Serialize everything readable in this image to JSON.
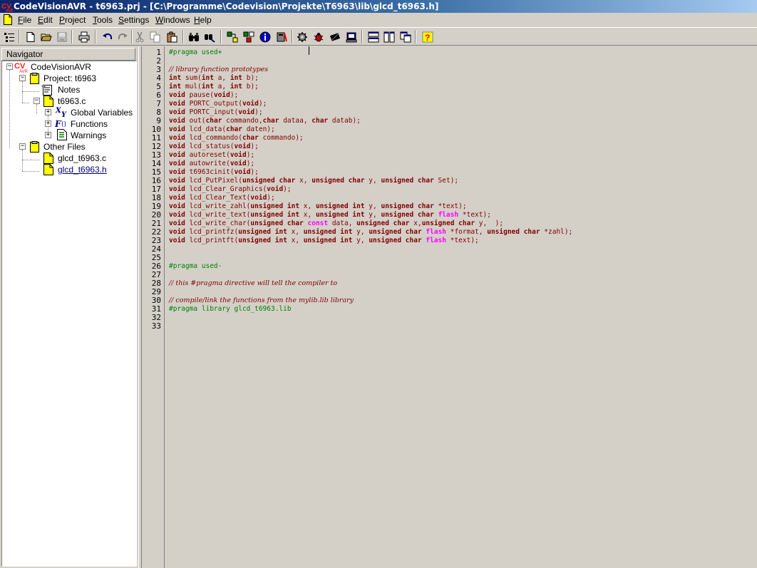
{
  "window": {
    "title": "CodeVisionAVR - t6963.prj - [C:\\Programme\\Codevision\\Projekte\\T6963\\lib\\glcd_t6963.h]"
  },
  "menu": {
    "items": [
      "File",
      "Edit",
      "Project",
      "Tools",
      "Settings",
      "Windows",
      "Help"
    ],
    "accelerators": [
      "F",
      "E",
      "P",
      "T",
      "S",
      "W",
      "H"
    ]
  },
  "toolbar": {
    "buttons": [
      "navigator-icon",
      "new-file-icon",
      "open-file-icon",
      "save-icon",
      "print-icon",
      "undo-icon",
      "redo-icon",
      "cut-icon",
      "copy-icon",
      "paste-icon",
      "find-icon",
      "replace-icon",
      "check-syntax-icon",
      "compile-icon",
      "info-icon",
      "make-icon",
      "settings-gear-icon",
      "debugger-bug-icon",
      "chip-programmer-icon",
      "terminal-icon",
      "tile-horizontal-icon",
      "tile-vertical-icon",
      "cascade-icon",
      "help-icon"
    ]
  },
  "navigator": {
    "header": "Navigator",
    "tree": {
      "root": "CodeVisionAVR",
      "project": "Project: t6963",
      "notes": "Notes",
      "source": "t6963.c",
      "global_vars": "Global Variables",
      "functions": "Functions",
      "warnings": "Warnings",
      "other_files": "Other Files",
      "file1": "glcd_t6963.c",
      "file2": "glcd_t6963.h"
    }
  },
  "editor": {
    "line_numbers": [
      "1",
      "2",
      "3",
      "4",
      "5",
      "6",
      "7",
      "8",
      "9",
      "10",
      "11",
      "12",
      "13",
      "14",
      "15",
      "16",
      "17",
      "18",
      "19",
      "20",
      "21",
      "22",
      "23",
      "24",
      "25",
      "26",
      "27",
      "28",
      "29",
      "30",
      "31",
      "32",
      "33"
    ],
    "lines": [
      [
        [
          "pp",
          "#pragma used+"
        ]
      ],
      [],
      [
        [
          "cm",
          "// library function prototypes"
        ]
      ],
      [
        [
          "kw",
          "int"
        ],
        [
          "t",
          " sum("
        ],
        [
          "kw",
          "int"
        ],
        [
          "t",
          " a, "
        ],
        [
          "kw",
          "int"
        ],
        [
          "t",
          " b);"
        ]
      ],
      [
        [
          "kw",
          "int"
        ],
        [
          "t",
          " mul("
        ],
        [
          "kw",
          "int"
        ],
        [
          "t",
          " a, "
        ],
        [
          "kw",
          "int"
        ],
        [
          "t",
          " b);"
        ]
      ],
      [
        [
          "kw",
          "void"
        ],
        [
          "t",
          " pause("
        ],
        [
          "kw",
          "void"
        ],
        [
          "t",
          ");"
        ]
      ],
      [
        [
          "kw",
          "void"
        ],
        [
          "t",
          " PORTC_output("
        ],
        [
          "kw",
          "void"
        ],
        [
          "t",
          ");"
        ]
      ],
      [
        [
          "kw",
          "void"
        ],
        [
          "t",
          " PORTC_input("
        ],
        [
          "kw",
          "void"
        ],
        [
          "t",
          ");"
        ]
      ],
      [
        [
          "kw",
          "void"
        ],
        [
          "t",
          " out("
        ],
        [
          "kw",
          "char"
        ],
        [
          "t",
          " commando,"
        ],
        [
          "kw",
          "char"
        ],
        [
          "t",
          " dataa, "
        ],
        [
          "kw",
          "char"
        ],
        [
          "t",
          " datab);"
        ]
      ],
      [
        [
          "kw",
          "void"
        ],
        [
          "t",
          " lcd_data("
        ],
        [
          "kw",
          "char"
        ],
        [
          "t",
          " daten);"
        ]
      ],
      [
        [
          "kw",
          "void"
        ],
        [
          "t",
          " lcd_commando("
        ],
        [
          "kw",
          "char"
        ],
        [
          "t",
          " commando);"
        ]
      ],
      [
        [
          "kw",
          "void"
        ],
        [
          "t",
          " lcd_status("
        ],
        [
          "kw",
          "void"
        ],
        [
          "t",
          ");"
        ]
      ],
      [
        [
          "kw",
          "void"
        ],
        [
          "t",
          " autoreset("
        ],
        [
          "kw",
          "void"
        ],
        [
          "t",
          ");"
        ]
      ],
      [
        [
          "kw",
          "void"
        ],
        [
          "t",
          " autowrite("
        ],
        [
          "kw",
          "void"
        ],
        [
          "t",
          ");"
        ]
      ],
      [
        [
          "kw",
          "void"
        ],
        [
          "t",
          " t6963cinit("
        ],
        [
          "kw",
          "void"
        ],
        [
          "t",
          ");"
        ]
      ],
      [
        [
          "kw",
          "void"
        ],
        [
          "t",
          " lcd_PutPixel("
        ],
        [
          "kw",
          "unsigned char"
        ],
        [
          "t",
          " x, "
        ],
        [
          "kw",
          "unsigned char"
        ],
        [
          "t",
          " y, "
        ],
        [
          "kw",
          "unsigned char"
        ],
        [
          "t",
          " Set);"
        ]
      ],
      [
        [
          "kw",
          "void"
        ],
        [
          "t",
          " lcd_Clear_Graphics("
        ],
        [
          "kw",
          "void"
        ],
        [
          "t",
          ");"
        ]
      ],
      [
        [
          "kw",
          "void"
        ],
        [
          "t",
          " lcd_Clear_Text("
        ],
        [
          "kw",
          "void"
        ],
        [
          "t",
          ");"
        ]
      ],
      [
        [
          "kw",
          "void"
        ],
        [
          "t",
          " lcd_write_zahl("
        ],
        [
          "kw",
          "unsigned int"
        ],
        [
          "t",
          " x, "
        ],
        [
          "kw",
          "unsigned int"
        ],
        [
          "t",
          " y, "
        ],
        [
          "kw",
          "unsigned char"
        ],
        [
          "t",
          " *text);"
        ]
      ],
      [
        [
          "kw",
          "void"
        ],
        [
          "t",
          " lcd_write_text("
        ],
        [
          "kw",
          "unsigned int"
        ],
        [
          "t",
          " x, "
        ],
        [
          "kw",
          "unsigned int"
        ],
        [
          "t",
          " y, "
        ],
        [
          "kw",
          "unsigned char"
        ],
        [
          "t",
          " "
        ],
        [
          "mg",
          "flash"
        ],
        [
          "t",
          " *text);"
        ]
      ],
      [
        [
          "kw",
          "void"
        ],
        [
          "t",
          " lcd_write_char("
        ],
        [
          "kw",
          "unsigned char"
        ],
        [
          "t",
          " "
        ],
        [
          "mg",
          "const"
        ],
        [
          "t",
          " data, "
        ],
        [
          "kw",
          "unsigned char"
        ],
        [
          "t",
          " x,"
        ],
        [
          "kw",
          "unsigned char"
        ],
        [
          "t",
          " y,  );"
        ]
      ],
      [
        [
          "kw",
          "void"
        ],
        [
          "t",
          " lcd_printfz("
        ],
        [
          "kw",
          "unsigned int"
        ],
        [
          "t",
          " x, "
        ],
        [
          "kw",
          "unsigned int"
        ],
        [
          "t",
          " y, "
        ],
        [
          "kw",
          "unsigned char"
        ],
        [
          "t",
          " "
        ],
        [
          "mg",
          "flash"
        ],
        [
          "t",
          " *format, "
        ],
        [
          "kw",
          "unsigned char"
        ],
        [
          "t",
          " *zahl);"
        ]
      ],
      [
        [
          "kw",
          "void"
        ],
        [
          "t",
          " lcd_printft("
        ],
        [
          "kw",
          "unsigned int"
        ],
        [
          "t",
          " x, "
        ],
        [
          "kw",
          "unsigned int"
        ],
        [
          "t",
          " y, "
        ],
        [
          "kw",
          "unsigned char"
        ],
        [
          "t",
          " "
        ],
        [
          "mg",
          "flash"
        ],
        [
          "t",
          " *text);"
        ]
      ],
      [],
      [],
      [
        [
          "pp",
          "#pragma used-"
        ]
      ],
      [],
      [
        [
          "cm",
          "// this #pragma directive will tell the compiler to"
        ]
      ],
      [],
      [
        [
          "cm",
          "// compile/link the functions from the mylib.lib library"
        ]
      ],
      [
        [
          "pp",
          "#pragma library glcd_t6963.lib"
        ]
      ],
      [],
      []
    ]
  }
}
